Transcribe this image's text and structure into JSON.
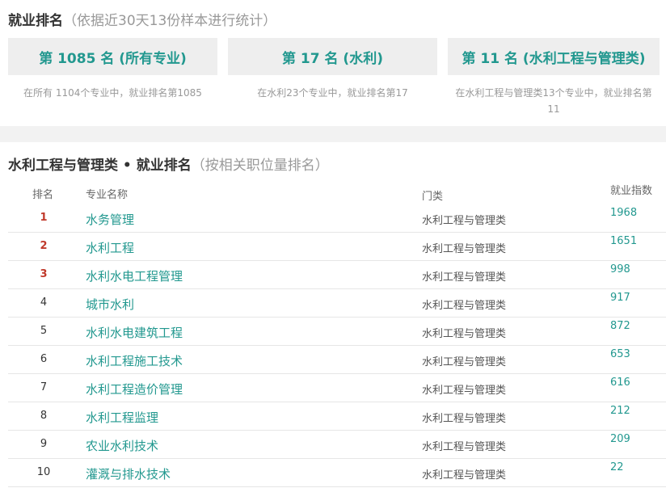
{
  "summary": {
    "title": "就业排名",
    "subtitle": "（依据近30天13份样本进行统计）",
    "cards": [
      {
        "rank": "第 1085 名 (所有专业)",
        "desc": "在所有 1104个专业中，就业排名第1085"
      },
      {
        "rank": "第 17 名 (水利)",
        "desc": "在水利23个专业中，就业排名第17"
      },
      {
        "rank": "第 11 名 (水利工程与管理类)",
        "desc": "在水利工程与管理类13个专业中，就业排名第11"
      }
    ]
  },
  "ranking": {
    "title": "水利工程与管理类 • 就业排名",
    "subtitle": "（按相关职位量排名）",
    "headers": {
      "rank": "排名",
      "name": "专业名称",
      "category": "门类",
      "score": "就业指数"
    },
    "rows": [
      {
        "rank": "1",
        "name": "水务管理",
        "category": "水利工程与管理类",
        "score": "1968"
      },
      {
        "rank": "2",
        "name": "水利工程",
        "category": "水利工程与管理类",
        "score": "1651"
      },
      {
        "rank": "3",
        "name": "水利水电工程管理",
        "category": "水利工程与管理类",
        "score": "998"
      },
      {
        "rank": "4",
        "name": "城市水利",
        "category": "水利工程与管理类",
        "score": "917"
      },
      {
        "rank": "5",
        "name": "水利水电建筑工程",
        "category": "水利工程与管理类",
        "score": "872"
      },
      {
        "rank": "6",
        "name": "水利工程施工技术",
        "category": "水利工程与管理类",
        "score": "653"
      },
      {
        "rank": "7",
        "name": "水利工程造价管理",
        "category": "水利工程与管理类",
        "score": "616"
      },
      {
        "rank": "8",
        "name": "水利工程监理",
        "category": "水利工程与管理类",
        "score": "212"
      },
      {
        "rank": "9",
        "name": "农业水利技术",
        "category": "水利工程与管理类",
        "score": "209"
      },
      {
        "rank": "10",
        "name": "灌溉与排水技术",
        "category": "水利工程与管理类",
        "score": "22"
      }
    ]
  },
  "colors": {
    "accent": "#22988f",
    "top_rank": "#c0392b",
    "muted": "#999999",
    "card_bg": "#eeeeee"
  }
}
